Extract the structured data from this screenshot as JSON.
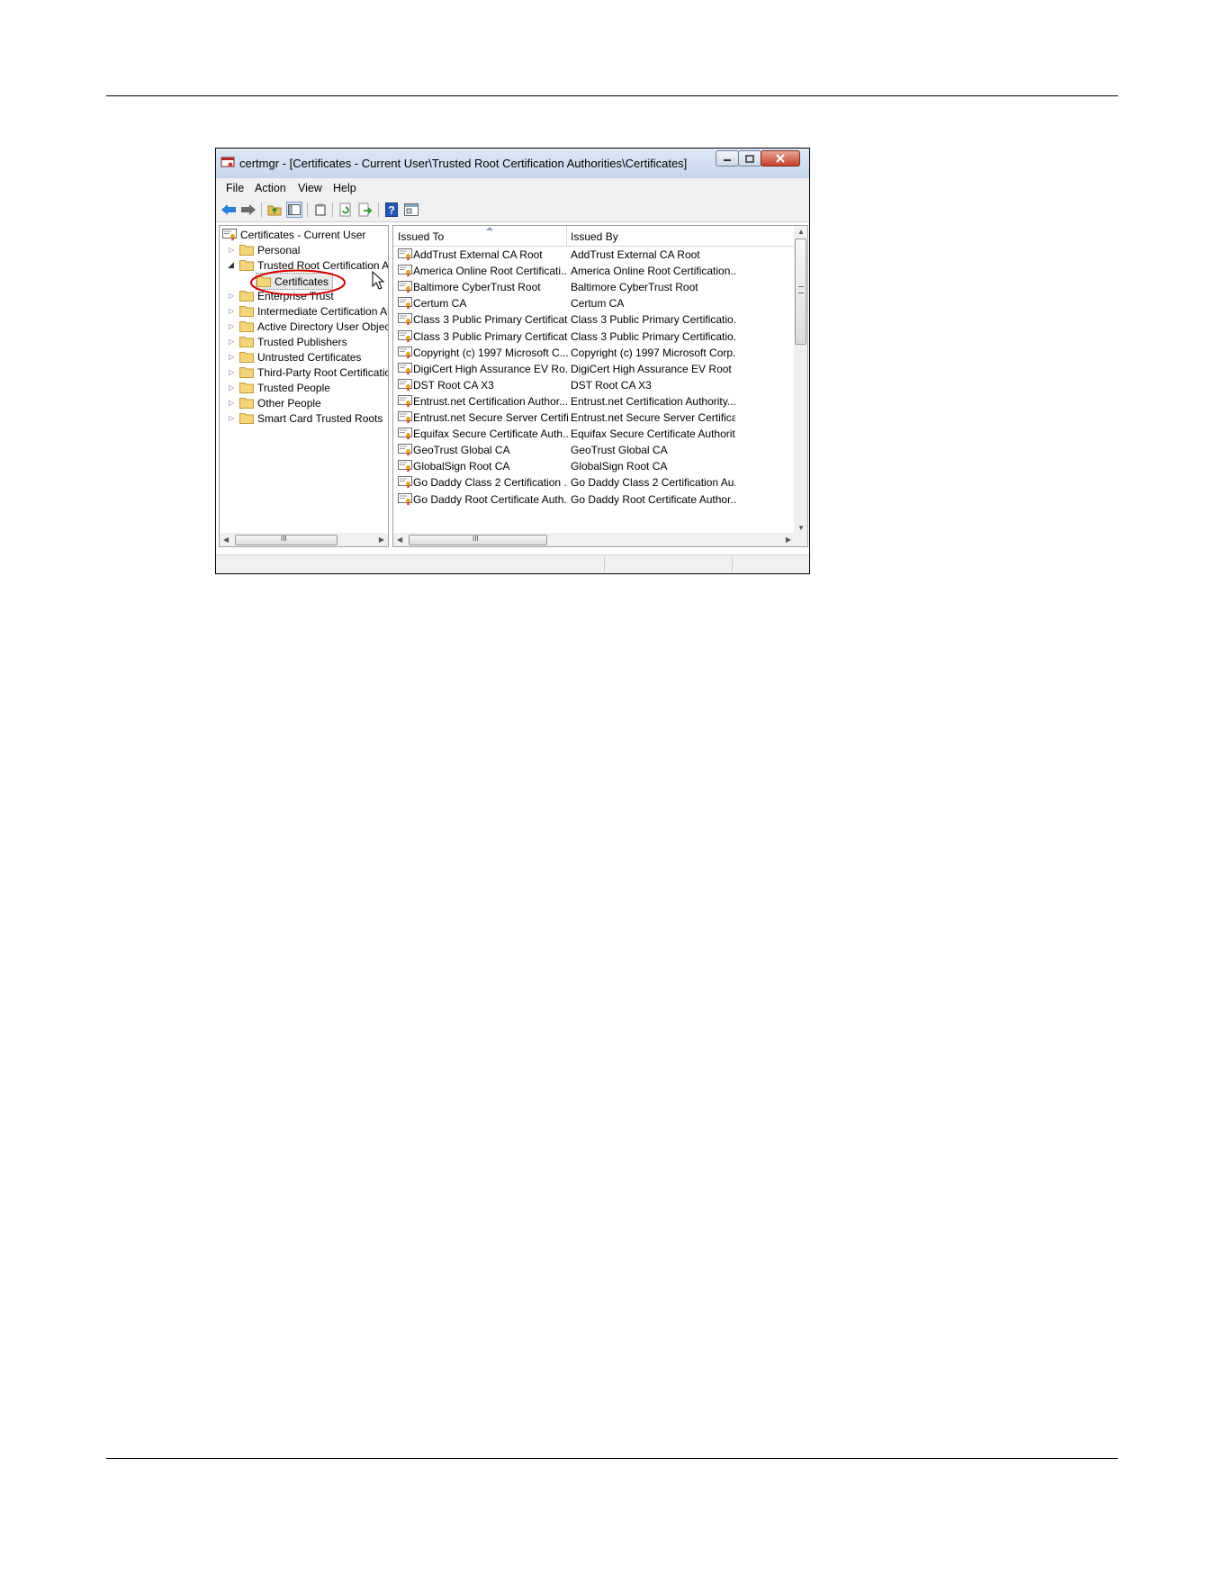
{
  "window": {
    "title": "certmgr - [Certificates - Current User\\Trusted Root Certification Authorities\\Certificates]"
  },
  "menu": [
    "File",
    "Action",
    "View",
    "Help"
  ],
  "toolbar_icons": [
    "back-arrow-icon",
    "forward-arrow-icon",
    "up-folder-icon",
    "show-hide-tree-icon",
    "clipboard-icon",
    "refresh-icon",
    "export-list-icon",
    "help-icon",
    "properties-icon"
  ],
  "tree": {
    "root": "Certificates - Current User",
    "items": [
      {
        "label": "Personal",
        "expanded": false
      },
      {
        "label": "Trusted Root Certification Au",
        "expanded": true,
        "children": [
          {
            "label": "Certificates",
            "selected": true
          }
        ]
      },
      {
        "label": "Enterprise Trust",
        "expanded": false
      },
      {
        "label": "Intermediate Certification Au",
        "expanded": false
      },
      {
        "label": "Active Directory User Object",
        "expanded": false
      },
      {
        "label": "Trusted Publishers",
        "expanded": false
      },
      {
        "label": "Untrusted Certificates",
        "expanded": false
      },
      {
        "label": "Third-Party Root Certificatior",
        "expanded": false
      },
      {
        "label": "Trusted People",
        "expanded": false
      },
      {
        "label": "Other People",
        "expanded": false
      },
      {
        "label": "Smart Card Trusted Roots",
        "expanded": false
      }
    ]
  },
  "list": {
    "columns": [
      "Issued To",
      "Issued By"
    ],
    "rows": [
      [
        "AddTrust External CA Root",
        "AddTrust External CA Root"
      ],
      [
        "America Online Root Certificati...",
        "America Online Root Certification..."
      ],
      [
        "Baltimore CyberTrust Root",
        "Baltimore CyberTrust Root"
      ],
      [
        "Certum CA",
        "Certum CA"
      ],
      [
        "Class 3 Public Primary Certificat...",
        "Class 3 Public Primary Certificatio..."
      ],
      [
        "Class 3 Public Primary Certificat...",
        "Class 3 Public Primary Certificatio..."
      ],
      [
        "Copyright (c) 1997 Microsoft C...",
        "Copyright (c) 1997 Microsoft Corp."
      ],
      [
        "DigiCert High Assurance EV Ro...",
        "DigiCert High Assurance EV Root ..."
      ],
      [
        "DST Root CA X3",
        "DST Root CA X3"
      ],
      [
        "Entrust.net Certification Author...",
        "Entrust.net Certification Authority..."
      ],
      [
        "Entrust.net Secure Server Certifi...",
        "Entrust.net Secure Server Certifica..."
      ],
      [
        "Equifax Secure Certificate Auth...",
        "Equifax Secure Certificate Authority"
      ],
      [
        "GeoTrust Global CA",
        "GeoTrust Global CA"
      ],
      [
        "GlobalSign Root CA",
        "GlobalSign Root CA"
      ],
      [
        "Go Daddy Class 2 Certification ...",
        "Go Daddy Class 2 Certification Au..."
      ],
      [
        "Go Daddy Root Certificate Auth...",
        "Go Daddy Root Certificate Author..."
      ]
    ]
  },
  "scrollbar_grip": "III",
  "colors": {
    "highlight_circle": "#d40000",
    "title_gradient_top": "#dfe9f5",
    "close_button": "#c7422a"
  }
}
